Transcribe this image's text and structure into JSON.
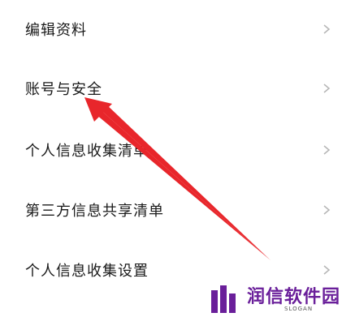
{
  "settings_menu": {
    "items": [
      {
        "label": "编辑资料"
      },
      {
        "label": "账号与安全"
      },
      {
        "label": "个人信息收集清单"
      },
      {
        "label": "第三方信息共享清单"
      },
      {
        "label": "个人信息收集设置"
      }
    ],
    "chevron_icon": "chevron-right-icon"
  },
  "annotation": {
    "arrow_color": "#e8262b"
  },
  "watermark": {
    "brand_text": "润信软件园",
    "slogan": "SLOGAN",
    "logo_color": "#6a1f9a"
  }
}
